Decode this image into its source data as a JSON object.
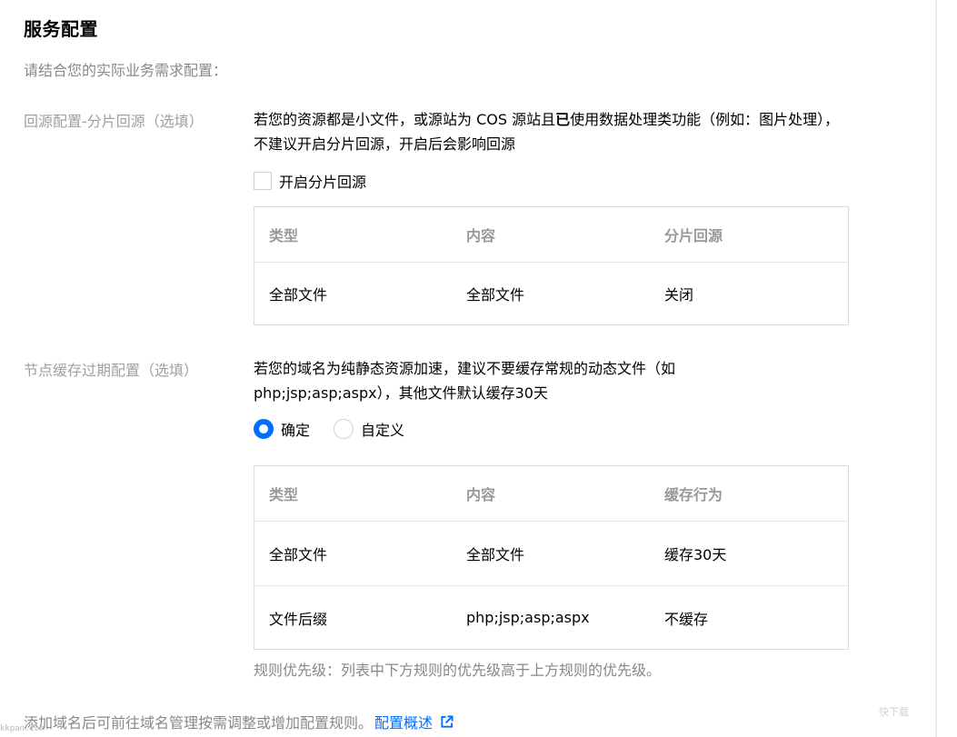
{
  "page": {
    "title": "服务配置",
    "intro": "请结合您的实际业务需求配置："
  },
  "range_origin": {
    "label": "回源配置-分片回源（选填）",
    "desc_part1": "若您的资源都是小文件，或源站为 COS 源站且",
    "desc_bold": "已",
    "desc_part2": "使用数据处理类功能（例如：图片处理），不建议开启分片回源，开启后会影响回源",
    "checkbox_label": "开启分片回源",
    "checkbox_checked": false,
    "table": {
      "headers": [
        "类型",
        "内容",
        "分片回源"
      ],
      "rows": [
        [
          "全部文件",
          "全部文件",
          "关闭"
        ]
      ]
    }
  },
  "cache_expire": {
    "label": "节点缓存过期配置（选填）",
    "desc": "若您的域名为纯静态资源加速，建议不要缓存常规的动态文件（如php;jsp;asp;aspx），其他文件默认缓存30天",
    "radio_options": [
      {
        "label": "确定",
        "checked": true
      },
      {
        "label": "自定义",
        "checked": false
      }
    ],
    "table": {
      "headers": [
        "类型",
        "内容",
        "缓存行为"
      ],
      "rows": [
        [
          "全部文件",
          "全部文件",
          "缓存30天"
        ],
        [
          "文件后缀",
          "php;jsp;asp;aspx",
          "不缓存"
        ]
      ]
    },
    "note": "规则优先级：列表中下方规则的优先级高于上方规则的优先级。"
  },
  "footer": {
    "text": "添加域名后可前往域名管理按需调整或增加配置规则。",
    "link": "配置概述",
    "link_icon": "external-link-icon"
  },
  "watermarks": {
    "left": "kkpan.com",
    "right": "快下载"
  },
  "colors": {
    "accent": "#006eff",
    "muted_text": "#888888",
    "border": "#dcdcdc"
  }
}
